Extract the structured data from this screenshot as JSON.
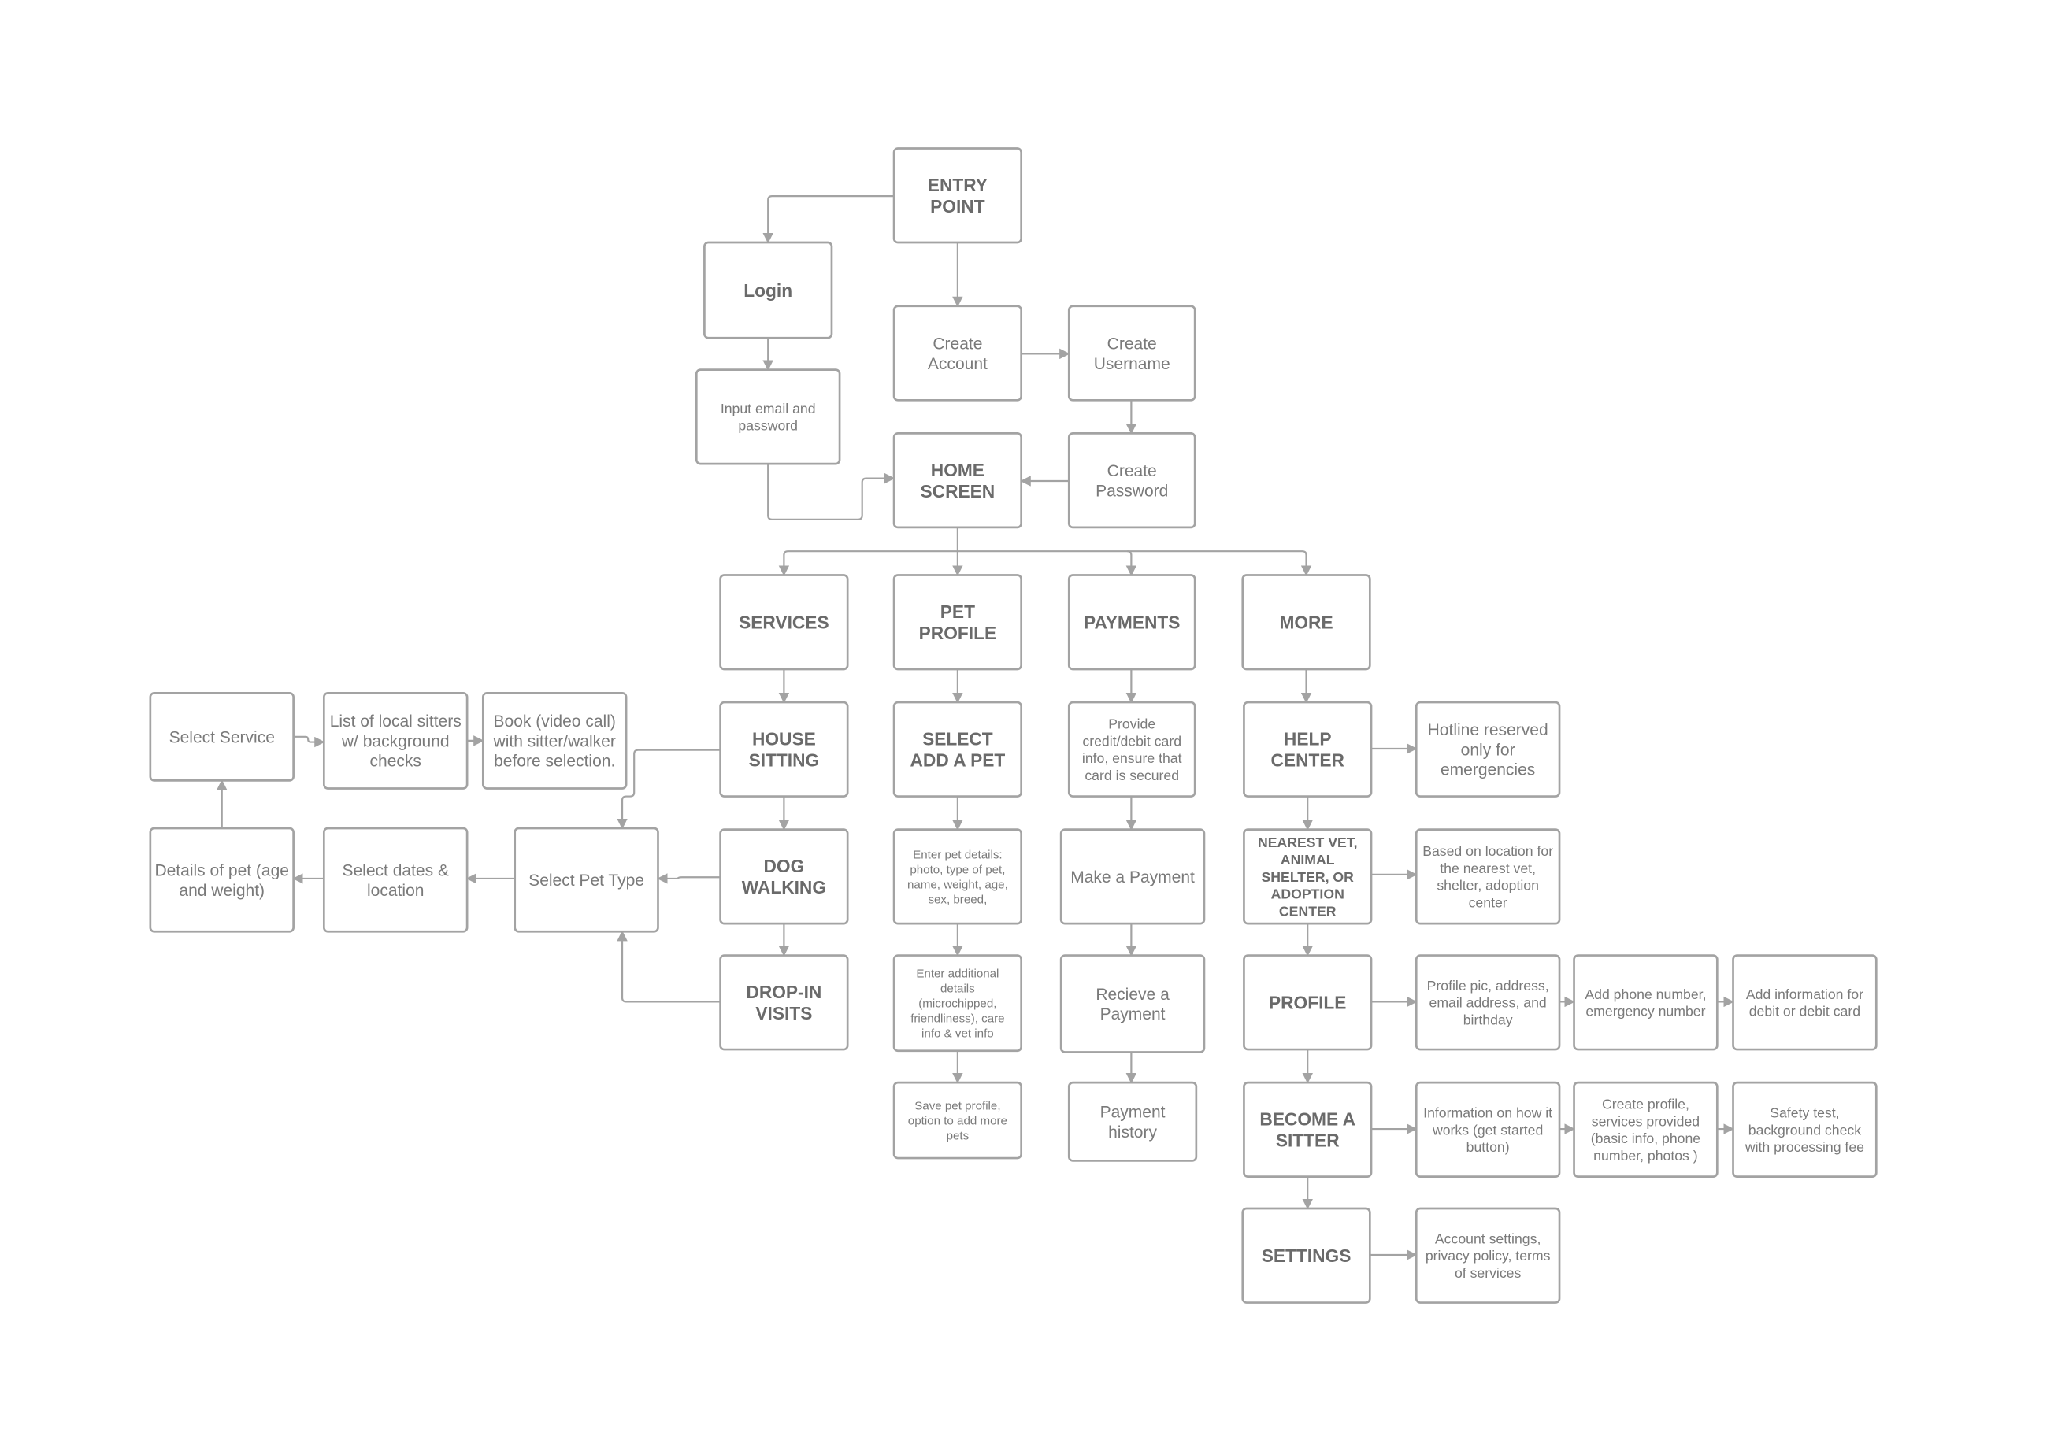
{
  "colors": {
    "stroke": "#a3a3a3",
    "text": "#7a7a7a",
    "bold_text": "#6a6a6a",
    "background": "#ffffff"
  },
  "nodes": [
    {
      "id": "entry",
      "lines": [
        "ENTRY",
        "POINT"
      ]
    },
    {
      "id": "login",
      "lines": [
        "Login"
      ]
    },
    {
      "id": "input",
      "lines": [
        "Input email and",
        "password"
      ]
    },
    {
      "id": "createAccount",
      "lines": [
        "Create",
        "Account"
      ]
    },
    {
      "id": "createUsername",
      "lines": [
        "Create",
        "Username"
      ]
    },
    {
      "id": "home",
      "lines": [
        "HOME",
        "SCREEN"
      ]
    },
    {
      "id": "createPassword",
      "lines": [
        "Create",
        "Password"
      ]
    },
    {
      "id": "services",
      "lines": [
        "SERVICES"
      ]
    },
    {
      "id": "petProfile",
      "lines": [
        "PET",
        "PROFILE"
      ]
    },
    {
      "id": "payments",
      "lines": [
        "PAYMENTS"
      ]
    },
    {
      "id": "more",
      "lines": [
        "MORE"
      ]
    },
    {
      "id": "houseSitting",
      "lines": [
        "HOUSE",
        "SITTING"
      ]
    },
    {
      "id": "selectPet",
      "lines": [
        "SELECT",
        "ADD A PET"
      ]
    },
    {
      "id": "provideCard",
      "lines": [
        "Provide",
        "credit/debit card",
        "info, ensure that",
        "card is secured"
      ]
    },
    {
      "id": "help",
      "lines": [
        "HELP",
        "CENTER"
      ]
    },
    {
      "id": "hotline",
      "lines": [
        "Hotline reserved",
        "only for",
        "emergencies"
      ]
    },
    {
      "id": "dogWalking",
      "lines": [
        "DOG",
        "WALKING"
      ]
    },
    {
      "id": "enterPet",
      "lines": [
        "Enter pet details:",
        "photo, type of pet,",
        "name, weight, age,",
        "sex, breed,"
      ]
    },
    {
      "id": "makePayment",
      "lines": [
        "Make a Payment"
      ]
    },
    {
      "id": "nearest",
      "lines": [
        "NEAREST VET,",
        "ANIMAL",
        "SHELTER, OR",
        "ADOPTION",
        "CENTER"
      ]
    },
    {
      "id": "basedLoc",
      "lines": [
        "Based on location for",
        "the nearest vet,",
        "shelter, adoption",
        "center"
      ]
    },
    {
      "id": "dropIn",
      "lines": [
        "DROP-IN",
        "VISITS"
      ]
    },
    {
      "id": "enterAdd",
      "lines": [
        "Enter additional",
        "details",
        "(microchipped,",
        "friendliness), care",
        "info & vet info"
      ]
    },
    {
      "id": "receive",
      "lines": [
        "Recieve a",
        "Payment"
      ]
    },
    {
      "id": "profile",
      "lines": [
        "PROFILE"
      ]
    },
    {
      "id": "profilePic",
      "lines": [
        "Profile pic, address,",
        "email address, and",
        "birthday"
      ]
    },
    {
      "id": "addPhone",
      "lines": [
        "Add phone number,",
        "emergency number"
      ]
    },
    {
      "id": "addInfo",
      "lines": [
        "Add information for",
        "debit or debit card"
      ]
    },
    {
      "id": "savePet",
      "lines": [
        "Save pet profile,",
        "option to add more",
        "pets"
      ]
    },
    {
      "id": "paymentHistory",
      "lines": [
        "Payment",
        "history"
      ]
    },
    {
      "id": "become",
      "lines": [
        "BECOME A",
        "SITTER"
      ]
    },
    {
      "id": "infoHow",
      "lines": [
        "Information on how it",
        "works (get started",
        "button)"
      ]
    },
    {
      "id": "createProf",
      "lines": [
        "Create profile,",
        "services provided",
        "(basic info, phone",
        "number, photos )"
      ]
    },
    {
      "id": "safety",
      "lines": [
        "Safety test,",
        "background check",
        "with processing fee"
      ]
    },
    {
      "id": "settings",
      "lines": [
        "SETTINGS"
      ]
    },
    {
      "id": "account",
      "lines": [
        "Account settings,",
        "privacy policy, terms",
        "of services"
      ]
    },
    {
      "id": "selectService",
      "lines": [
        "Select Service"
      ]
    },
    {
      "id": "listSitters",
      "lines": [
        "List of local sitters",
        "w/ background",
        "checks"
      ]
    },
    {
      "id": "book",
      "lines": [
        "Book (video call)",
        "with sitter/walker",
        "before selection."
      ]
    },
    {
      "id": "selectPetType",
      "lines": [
        "Select Pet Type"
      ]
    },
    {
      "id": "selectDates",
      "lines": [
        "Select dates &",
        "location"
      ]
    },
    {
      "id": "details",
      "lines": [
        "Details of pet (age",
        "and weight)"
      ]
    }
  ],
  "edges": [
    [
      "entry",
      "login"
    ],
    [
      "entry",
      "createAccount"
    ],
    [
      "login",
      "input"
    ],
    [
      "createAccount",
      "createUsername"
    ],
    [
      "createUsername",
      "createPassword"
    ],
    [
      "createPassword",
      "home"
    ],
    [
      "input",
      "home"
    ],
    [
      "home",
      "services"
    ],
    [
      "home",
      "petProfile"
    ],
    [
      "home",
      "payments"
    ],
    [
      "home",
      "more"
    ],
    [
      "services",
      "houseSitting"
    ],
    [
      "houseSitting",
      "dogWalking"
    ],
    [
      "dogWalking",
      "dropIn"
    ],
    [
      "houseSitting",
      "selectPetType"
    ],
    [
      "dogWalking",
      "selectPetType"
    ],
    [
      "dropIn",
      "selectPetType"
    ],
    [
      "selectPetType",
      "selectDates"
    ],
    [
      "selectDates",
      "details"
    ],
    [
      "details",
      "selectService"
    ],
    [
      "selectService",
      "listSitters"
    ],
    [
      "listSitters",
      "book"
    ],
    [
      "petProfile",
      "selectPet"
    ],
    [
      "selectPet",
      "enterPet"
    ],
    [
      "enterPet",
      "enterAdd"
    ],
    [
      "enterAdd",
      "savePet"
    ],
    [
      "payments",
      "provideCard"
    ],
    [
      "provideCard",
      "makePayment"
    ],
    [
      "makePayment",
      "receive"
    ],
    [
      "receive",
      "paymentHistory"
    ],
    [
      "more",
      "help"
    ],
    [
      "help",
      "nearest"
    ],
    [
      "nearest",
      "profile"
    ],
    [
      "profile",
      "become"
    ],
    [
      "become",
      "settings"
    ],
    [
      "help",
      "hotline"
    ],
    [
      "nearest",
      "basedLoc"
    ],
    [
      "profile",
      "profilePic"
    ],
    [
      "profilePic",
      "addPhone"
    ],
    [
      "addPhone",
      "addInfo"
    ],
    [
      "become",
      "infoHow"
    ],
    [
      "infoHow",
      "createProf"
    ],
    [
      "createProf",
      "safety"
    ],
    [
      "settings",
      "account"
    ]
  ]
}
